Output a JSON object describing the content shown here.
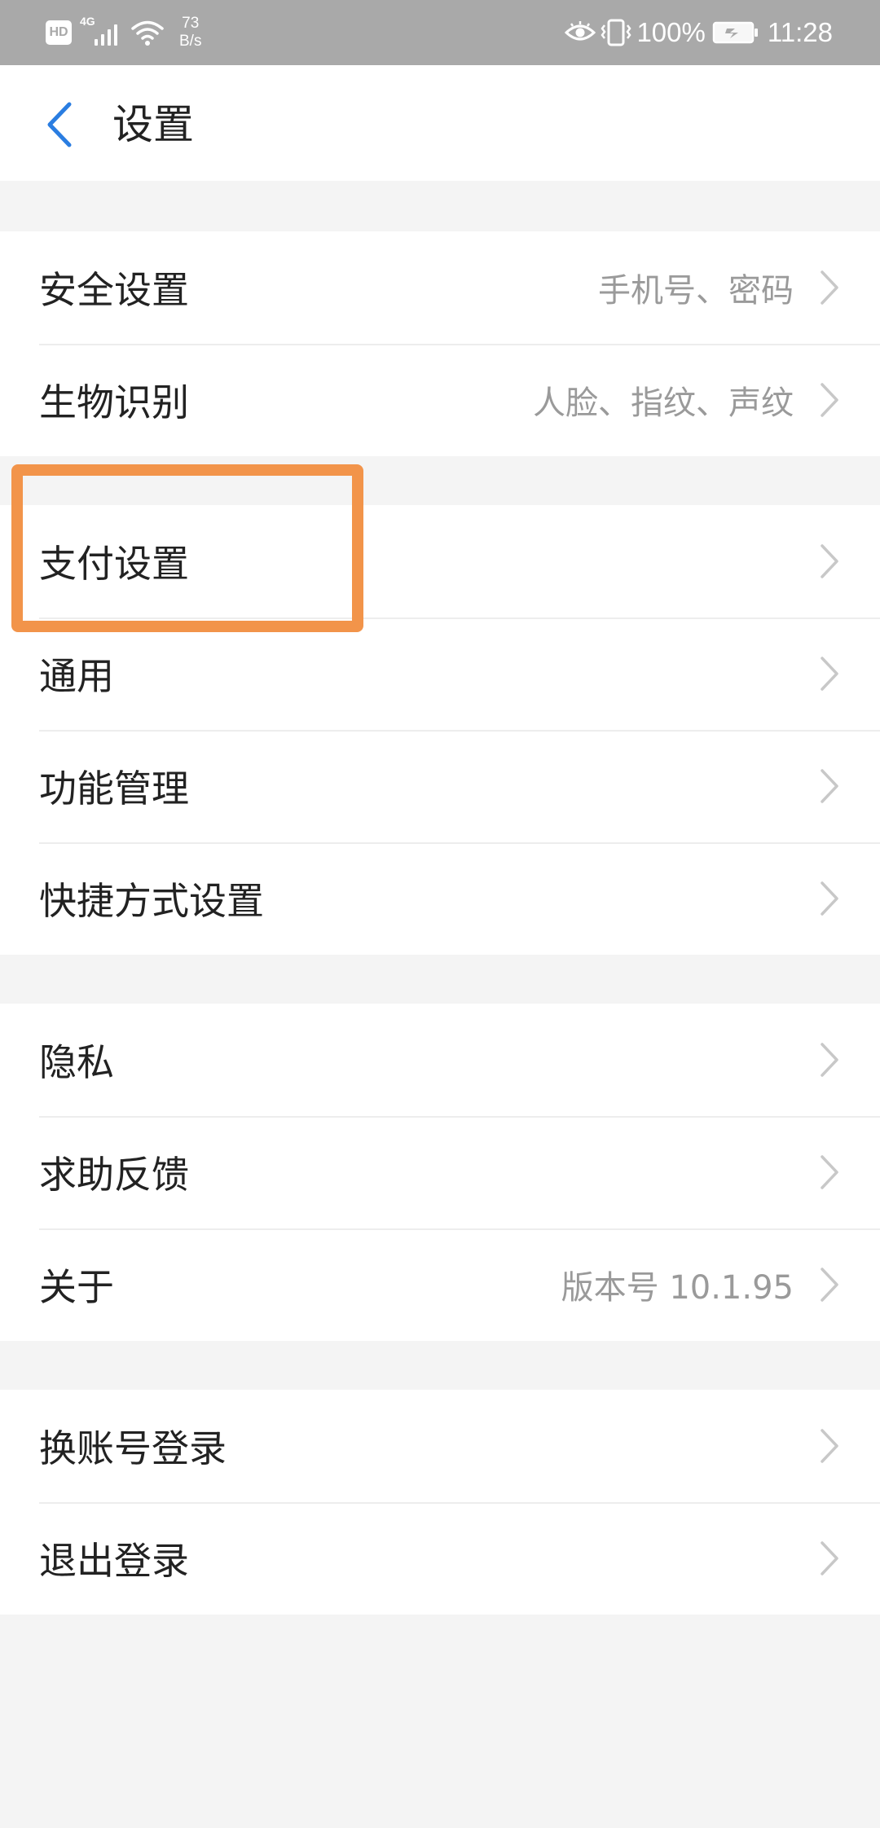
{
  "status_bar": {
    "hd_badge": "HD",
    "network_type": "4G",
    "net_speed_value": "73",
    "net_speed_unit": "B/s",
    "battery_percent": "100%",
    "time": "11:28"
  },
  "header": {
    "title": "设置"
  },
  "groups": [
    {
      "items": [
        {
          "label": "安全设置",
          "value": "手机号、密码"
        },
        {
          "label": "生物识别",
          "value": "人脸、指纹、声纹"
        }
      ]
    },
    {
      "items": [
        {
          "label": "支付设置",
          "value": ""
        },
        {
          "label": "通用",
          "value": ""
        },
        {
          "label": "功能管理",
          "value": ""
        },
        {
          "label": "快捷方式设置",
          "value": ""
        }
      ]
    },
    {
      "items": [
        {
          "label": "隐私",
          "value": ""
        },
        {
          "label": "求助反馈",
          "value": ""
        },
        {
          "label": "关于",
          "value": "版本号 10.1.95"
        }
      ]
    },
    {
      "items": [
        {
          "label": "换账号登录",
          "value": ""
        },
        {
          "label": "退出登录",
          "value": ""
        }
      ]
    }
  ],
  "colors": {
    "accent_blue": "#2a7de1",
    "highlight_orange": "#f2944a",
    "status_bar_bg": "#a9a9a9",
    "page_bg": "#f4f4f4"
  },
  "icons": {
    "back": "chevron-left-icon",
    "row_arrow": "chevron-right-icon"
  }
}
